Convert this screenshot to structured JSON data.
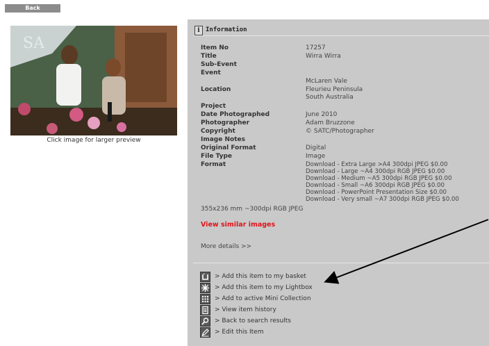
{
  "back_label": "Back",
  "preview_caption": "Click image for larger preview",
  "panel_title": "Information",
  "fields": [
    {
      "label": "Item No",
      "value": "17257"
    },
    {
      "label": "Title",
      "value": "Wirra Wirra"
    },
    {
      "label": "Sub-Event",
      "value": ""
    },
    {
      "label": "Event",
      "value": ""
    },
    {
      "label": "Location",
      "value": "McLaren Vale\nFleurieu Peninsula\nSouth Australia"
    },
    {
      "label": "Project",
      "value": ""
    },
    {
      "label": "Date Photographed",
      "value": "June 2010"
    },
    {
      "label": "Photographer",
      "value": "Adam Bruzzone"
    },
    {
      "label": "Copyright",
      "value": "© SATC/Photographer"
    },
    {
      "label": "Image Notes",
      "value": ""
    },
    {
      "label": "Original Format",
      "value": "Digital"
    },
    {
      "label": "File Type",
      "value": "Image"
    },
    {
      "label": "Format",
      "value": "Download - Extra Large >A4 300dpi JPEG $0.00\nDownload - Large ~A4 300dpi RGB JPEG $0.00\nDownload - Medium ~A5 300dpi RGB JPEG $0.00\nDownload - Small ~A6 300dpi RGB JPEG $0.00\nDownload - PowerPoint Presentation Size $0.00\nDownload - Very small ~A7 300dpi RGB JPEG $0.00"
    }
  ],
  "size_line": "355x236 mm ~300dpi RGB JPEG",
  "similar_label": "View similar images",
  "more_details_label": "More details >>",
  "actions": [
    {
      "icon": "basket-icon",
      "label": "> Add this item to my basket"
    },
    {
      "icon": "lightbox-icon",
      "label": "> Add this item to my Lightbox"
    },
    {
      "icon": "mini-collection-icon",
      "label": "> Add to active Mini Collection"
    },
    {
      "icon": "history-icon",
      "label": "> View item history"
    },
    {
      "icon": "search-icon",
      "label": "> Back to search results"
    },
    {
      "icon": "edit-icon",
      "label": "> Edit this Item"
    }
  ],
  "colors": {
    "panel": "#c9c9c9",
    "accent_red": "#e0141a",
    "button": "#8c8c8c"
  }
}
